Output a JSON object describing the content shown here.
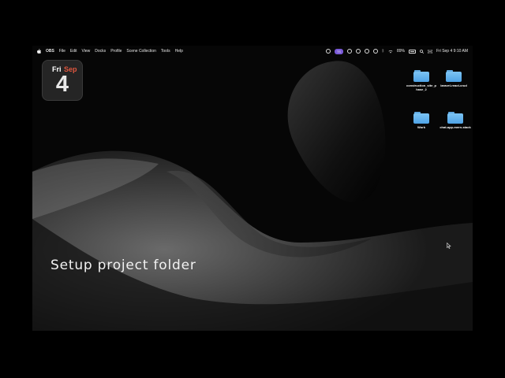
{
  "menubar": {
    "apple_icon": "apple-icon",
    "app_name": "OBS",
    "items": [
      "File",
      "Edit",
      "View",
      "Docks",
      "Profile",
      "Scene Collection",
      "Tools",
      "Help"
    ],
    "status": {
      "badge": "TS",
      "battery_percent": "89%",
      "datetime": "Fri Sep 4  9:10 AM"
    }
  },
  "calendar_widget": {
    "day": "Fri",
    "month": "Sep",
    "date": "4"
  },
  "desktop_icons": [
    {
      "label": "construction_site_phase_2"
    },
    {
      "label": "laravel-react-crud"
    },
    {
      "label": "Work"
    },
    {
      "label": "chat-app-mern-stack"
    }
  ],
  "caption": "Setup project folder",
  "colors": {
    "folder": "#6cb6ee",
    "calendar_month": "#e0573f",
    "badge": "#7a5ad8"
  }
}
